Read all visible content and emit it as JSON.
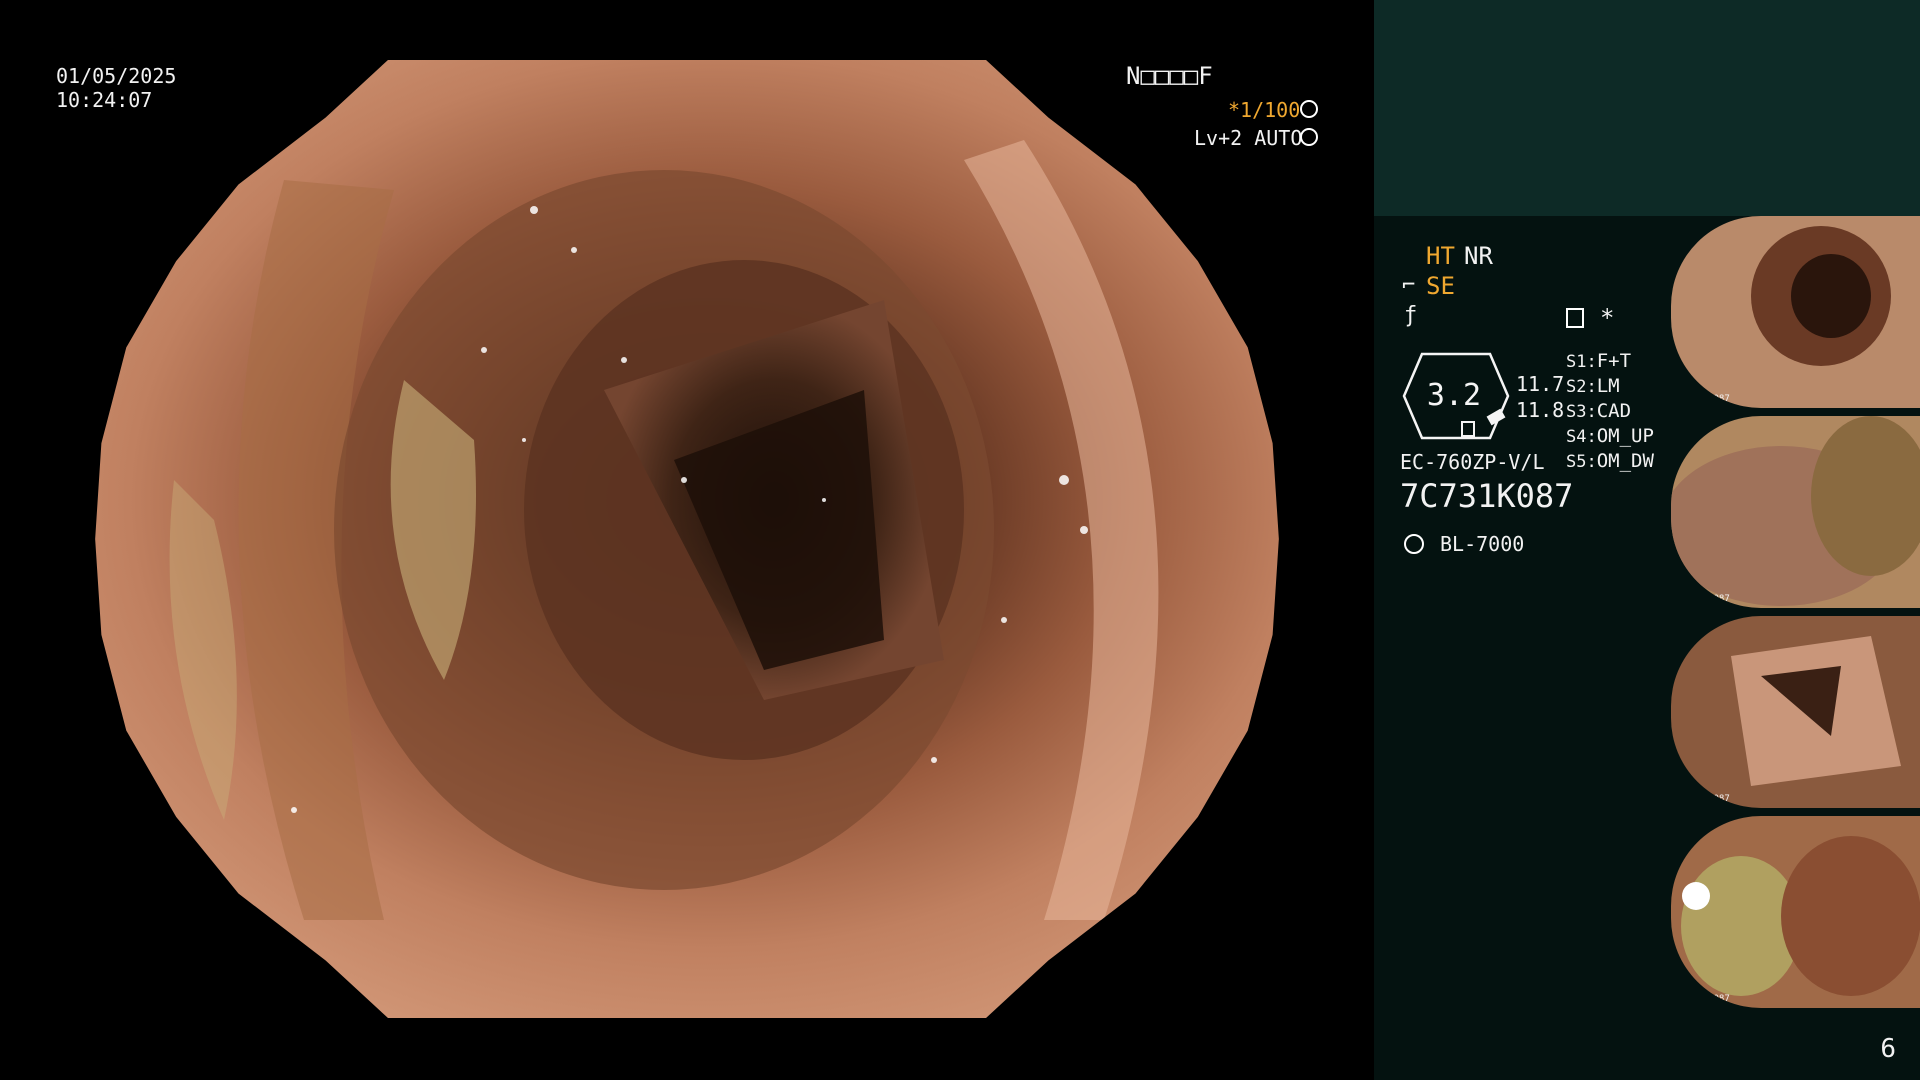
{
  "overlay": {
    "date": "01/05/2025",
    "time": "10:24:07",
    "patient_id": "N□□□□F",
    "shutter": "*1/100",
    "level": "Lv+2 AUTO"
  },
  "sidebar": {
    "mode_ht": "HT",
    "mode_nr": "NR",
    "mode_se": "SE",
    "asterisk": "*",
    "dial_value": "3.2",
    "dial_val_top": "11.7",
    "dial_val_bottom": "11.8",
    "settings": [
      {
        "key": "S1:",
        "value": "F+T"
      },
      {
        "key": "S2:",
        "value": "LM"
      },
      {
        "key": "S3:",
        "value": "CAD"
      },
      {
        "key": "S4:",
        "value": "OM_UP"
      },
      {
        "key": "S5:",
        "value": "OM_DW"
      }
    ],
    "scope_model": "EC-760ZP-V/L",
    "scope_serial": "7C731K087",
    "light_source": "BL-7000",
    "page_number": "6"
  },
  "thumbnails": [
    {
      "label": "7C731K087"
    },
    {
      "label": "7C731K087"
    },
    {
      "label": "7C731K087"
    },
    {
      "label": "7C731K087"
    }
  ],
  "colors": {
    "accent_orange": "#f0a830",
    "sidebar_top": "#0d2a26",
    "sidebar_bg": "#041210"
  },
  "icons": [
    "fan-icon",
    "gear-icon",
    "freeze-icon",
    "scope-icon",
    "menu-icon",
    "light-icon"
  ]
}
